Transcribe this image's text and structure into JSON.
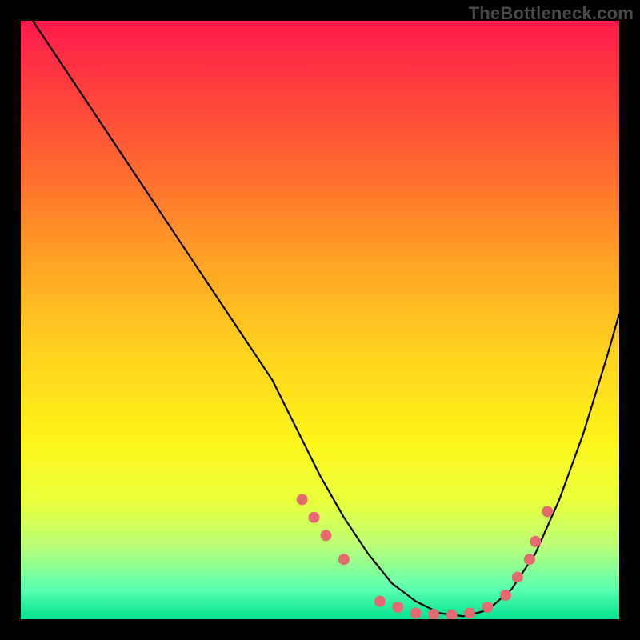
{
  "watermark": "TheBottleneck.com",
  "chart_data": {
    "type": "line",
    "title": "",
    "xlabel": "",
    "ylabel": "",
    "xlim": [
      0,
      100
    ],
    "ylim": [
      0,
      100
    ],
    "legend": false,
    "grid": false,
    "curve": {
      "x": [
        2,
        6,
        12,
        18,
        24,
        30,
        36,
        42,
        46,
        50,
        54,
        58,
        62,
        66,
        70,
        74,
        78,
        82,
        86,
        90,
        94,
        98,
        100
      ],
      "y": [
        100,
        94,
        85,
        76,
        67,
        58,
        49,
        40,
        32,
        24,
        17,
        11,
        6,
        3,
        1,
        0.5,
        1.5,
        5,
        11,
        20,
        31,
        44,
        51
      ]
    },
    "markers": {
      "color": "#e46a6f",
      "radius_px": 7,
      "points": [
        {
          "x": 47,
          "y": 20
        },
        {
          "x": 49,
          "y": 17
        },
        {
          "x": 51,
          "y": 14
        },
        {
          "x": 54,
          "y": 10
        },
        {
          "x": 60,
          "y": 3
        },
        {
          "x": 63,
          "y": 2
        },
        {
          "x": 66,
          "y": 1
        },
        {
          "x": 69,
          "y": 0.8
        },
        {
          "x": 72,
          "y": 0.7
        },
        {
          "x": 75,
          "y": 1
        },
        {
          "x": 78,
          "y": 2
        },
        {
          "x": 81,
          "y": 4
        },
        {
          "x": 83,
          "y": 7
        },
        {
          "x": 85,
          "y": 10
        },
        {
          "x": 86,
          "y": 13
        },
        {
          "x": 88,
          "y": 18
        }
      ]
    },
    "gradient_stops": [
      {
        "pct": 0,
        "hex": "#ff1a4d"
      },
      {
        "pct": 25,
        "hex": "#ff6a30"
      },
      {
        "pct": 55,
        "hex": "#ffd11f"
      },
      {
        "pct": 80,
        "hex": "#eaff3a"
      },
      {
        "pct": 100,
        "hex": "#00e38f"
      }
    ]
  }
}
